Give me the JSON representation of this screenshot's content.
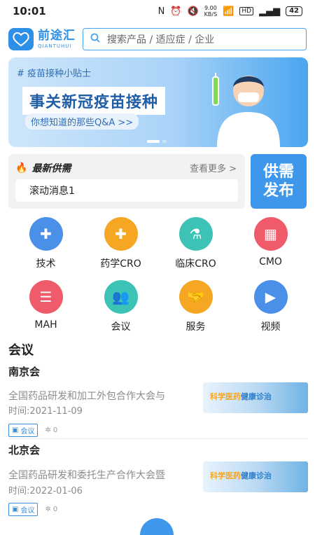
{
  "status": {
    "time": "10:01",
    "net_speed": "9.00\nKB/S",
    "battery": "42"
  },
  "header": {
    "logo_cn": "前途汇",
    "logo_en": "QIANTUHUI",
    "search_placeholder": "搜索产品 / 适应症 / 企业"
  },
  "banner": {
    "tag": "# 疫苗接种小贴士",
    "title": "事关新冠疫苗接种",
    "subtitle": "你想知道的那些Q&A >>"
  },
  "supply": {
    "title": "最新供需",
    "more": "查看更多 >",
    "message": "滚动消息1",
    "publish_line1": "供需",
    "publish_line2": "发布"
  },
  "categories": [
    {
      "label": "技术",
      "icon": "medkit-icon",
      "color": "#4a8fe8"
    },
    {
      "label": "药学CRO",
      "icon": "pharmacy-icon",
      "color": "#f5a623"
    },
    {
      "label": "临床CRO",
      "icon": "flask-icon",
      "color": "#3cc3b5"
    },
    {
      "label": "CMO",
      "icon": "factory-icon",
      "color": "#ef5b6a"
    },
    {
      "label": "MAH",
      "icon": "document-icon",
      "color": "#ef5b6a"
    },
    {
      "label": "会议",
      "icon": "people-icon",
      "color": "#3cc3b5"
    },
    {
      "label": "服务",
      "icon": "handshake-icon",
      "color": "#f5a623"
    },
    {
      "label": "视频",
      "icon": "video-icon",
      "color": "#4a8fe8"
    }
  ],
  "meetings": {
    "section_title": "会议",
    "items": [
      {
        "city": "南京会",
        "title": "全国药品研发和加工外包合作大会与",
        "time": "时间:2021-11-09",
        "tag": "会议",
        "views": "0",
        "thumb_a": "科学医药",
        "thumb_b": "健康诊治"
      },
      {
        "city": "北京会",
        "title": "全国药品研发和委托生产合作大会暨",
        "time": "时间:2022-01-06",
        "tag": "会议",
        "views": "0",
        "thumb_a": "科学医药",
        "thumb_b": "健康诊治"
      }
    ]
  }
}
